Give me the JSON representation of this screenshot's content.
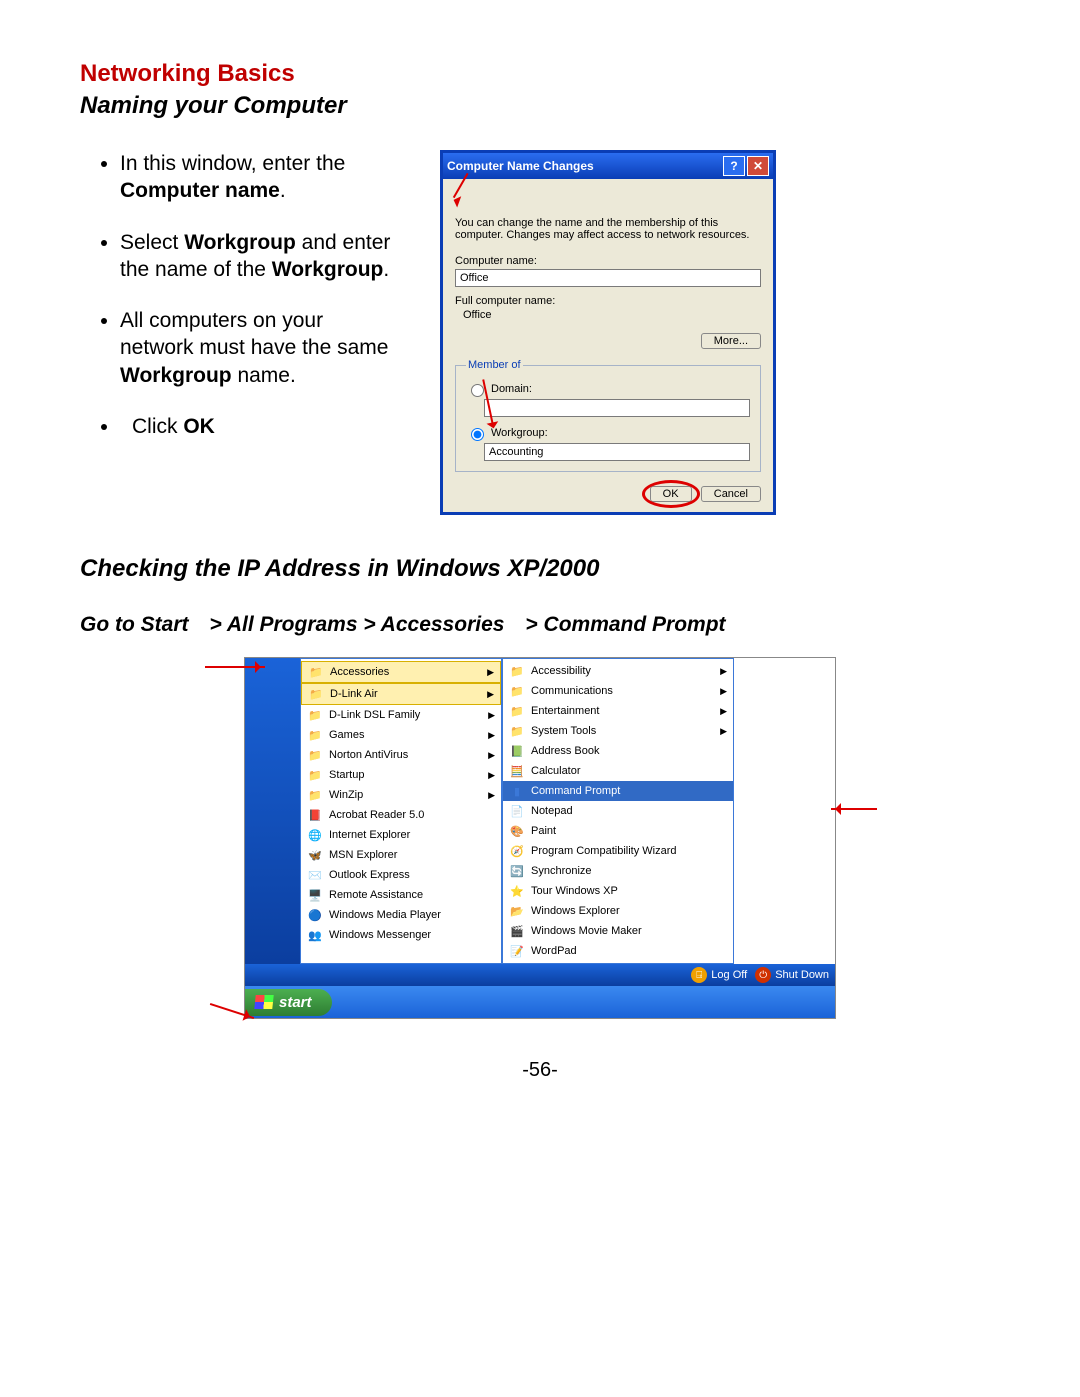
{
  "section_title": "Networking Basics",
  "subsection1": "Naming your Computer",
  "bullets": {
    "b1a": "In this window, enter the ",
    "b1b": "Computer name",
    "b1c": ".",
    "b2a": "Select ",
    "b2b": "Workgroup",
    "b2c": " and enter the name of the ",
    "b2d": "Workgroup",
    "b2e": ".",
    "b3a": "All computers on your network must have the same ",
    "b3b": "Workgroup",
    "b3c": " name.",
    "b4a": "Click ",
    "b4b": "OK"
  },
  "dialog": {
    "title": "Computer Name Changes",
    "desc": "You can change the name and the membership of this computer. Changes may affect access to network resources.",
    "comp_label": "Computer name:",
    "comp_value": "Office",
    "full_label": "Full computer name:",
    "full_value": "Office",
    "more": "More...",
    "member_legend": "Member of",
    "domain_label": "Domain:",
    "domain_value": "",
    "workgroup_label": "Workgroup:",
    "workgroup_value": "Accounting",
    "ok": "OK",
    "cancel": "Cancel"
  },
  "subsection2": "Checking the IP Address in Windows XP/2000",
  "path_line": "Go to Start > All Programs > Accessories > Command Prompt",
  "menu_left": [
    {
      "label": "Accessories",
      "icon": "folder",
      "sub": true,
      "sel": "y"
    },
    {
      "label": "D-Link Air",
      "icon": "folder",
      "sub": true,
      "sel": "y"
    },
    {
      "label": "D-Link DSL Family",
      "icon": "folder",
      "sub": true
    },
    {
      "label": "Games",
      "icon": "folder",
      "sub": true
    },
    {
      "label": "Norton AntiVirus",
      "icon": "folder",
      "sub": true
    },
    {
      "label": "Startup",
      "icon": "folder",
      "sub": true
    },
    {
      "label": "WinZip",
      "icon": "folder",
      "sub": true
    },
    {
      "label": "Acrobat Reader 5.0",
      "icon": "app-red"
    },
    {
      "label": "Internet Explorer",
      "icon": "ie"
    },
    {
      "label": "MSN Explorer",
      "icon": "msn"
    },
    {
      "label": "Outlook Express",
      "icon": "mail"
    },
    {
      "label": "Remote Assistance",
      "icon": "remote"
    },
    {
      "label": "Windows Media Player",
      "icon": "wmp"
    },
    {
      "label": "Windows Messenger",
      "icon": "msg"
    }
  ],
  "menu_right": [
    {
      "label": "Accessibility",
      "icon": "folder",
      "sub": true
    },
    {
      "label": "Communications",
      "icon": "folder",
      "sub": true
    },
    {
      "label": "Entertainment",
      "icon": "folder",
      "sub": true
    },
    {
      "label": "System Tools",
      "icon": "folder",
      "sub": true
    },
    {
      "label": "Address Book",
      "icon": "book"
    },
    {
      "label": "Calculator",
      "icon": "calc"
    },
    {
      "label": "Command Prompt",
      "icon": "cmd",
      "sel": "b"
    },
    {
      "label": "Notepad",
      "icon": "note"
    },
    {
      "label": "Paint",
      "icon": "paint"
    },
    {
      "label": "Program Compatibility Wizard",
      "icon": "wiz"
    },
    {
      "label": "Synchronize",
      "icon": "sync"
    },
    {
      "label": "Tour Windows XP",
      "icon": "tour"
    },
    {
      "label": "Windows Explorer",
      "icon": "explorer"
    },
    {
      "label": "Windows Movie Maker",
      "icon": "movie"
    },
    {
      "label": "WordPad",
      "icon": "wordpad"
    }
  ],
  "bottom": {
    "logoff": "Log Off",
    "shutdown": "Shut Down"
  },
  "start_label": "start",
  "page_number": "-56-"
}
